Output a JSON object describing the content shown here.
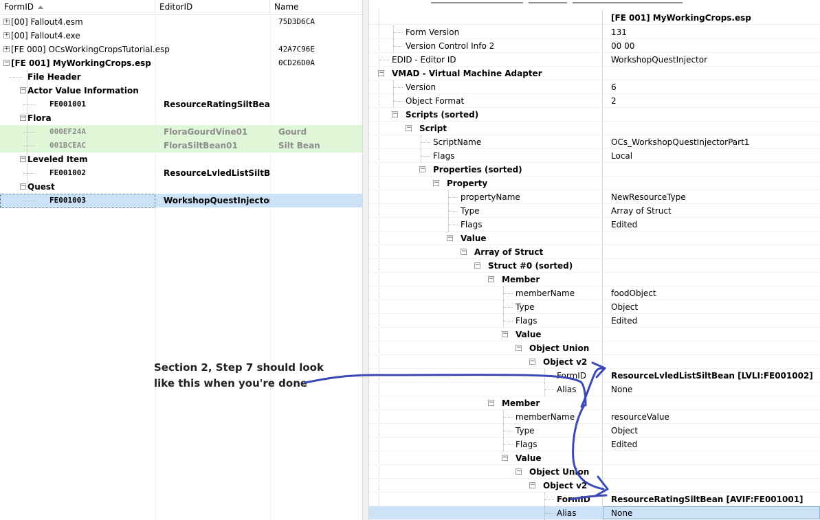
{
  "left_pane": {
    "columns": [
      "FormID",
      "EditorID",
      "Name"
    ],
    "sorted_column": "FormID",
    "rows": [
      {
        "depth": 0,
        "expander": "plus",
        "formid": "[00] Fallout4.esm",
        "editorid": "",
        "name": "75D3D6CA",
        "bold": false,
        "style": "normal"
      },
      {
        "depth": 0,
        "expander": "plus",
        "formid": "[00] Fallout4.exe",
        "editorid": "",
        "name": "",
        "bold": false,
        "style": "normal"
      },
      {
        "depth": 0,
        "expander": "plus",
        "formid": "[FE 000] OCsWorkingCropsTutorial.esp",
        "editorid": "",
        "name": "42A7C96E",
        "bold": false,
        "style": "normal"
      },
      {
        "depth": 0,
        "expander": "minus",
        "formid": "[FE 001] MyWorkingCrops.esp",
        "editorid": "",
        "name": "0CD26D0A",
        "bold": true,
        "style": "normal"
      },
      {
        "depth": 1,
        "expander": "none",
        "formid": "File Header",
        "editorid": "",
        "name": "",
        "bold": true,
        "style": "normal"
      },
      {
        "depth": 1,
        "expander": "minus",
        "formid": "Actor Value Information",
        "editorid": "",
        "name": "",
        "bold": true,
        "style": "normal"
      },
      {
        "depth": 2,
        "expander": "none",
        "formid": "FE001001",
        "editorid": "ResourceRatingSiltBean",
        "name": "",
        "bold": true,
        "style": "normal"
      },
      {
        "depth": 1,
        "expander": "minus",
        "formid": "Flora",
        "editorid": "",
        "name": "",
        "bold": true,
        "style": "normal"
      },
      {
        "depth": 2,
        "expander": "none",
        "formid": "000EF24A",
        "editorid": "FloraGourdVine01",
        "name": "Gourd",
        "bold": true,
        "style": "green"
      },
      {
        "depth": 2,
        "expander": "none",
        "formid": "001BCEAC",
        "editorid": "FloraSiltBean01",
        "name": "Silt Bean",
        "bold": true,
        "style": "green"
      },
      {
        "depth": 1,
        "expander": "minus",
        "formid": "Leveled Item",
        "editorid": "",
        "name": "",
        "bold": true,
        "style": "normal"
      },
      {
        "depth": 2,
        "expander": "none",
        "formid": "FE001002",
        "editorid": "ResourceLvledListSiltBean",
        "name": "",
        "bold": true,
        "style": "normal"
      },
      {
        "depth": 1,
        "expander": "minus",
        "formid": "Quest",
        "editorid": "",
        "name": "",
        "bold": true,
        "style": "normal"
      },
      {
        "depth": 2,
        "expander": "none",
        "formid": "FE001003",
        "editorid": "WorkshopQuestInjector",
        "name": "",
        "bold": true,
        "style": "selected"
      }
    ]
  },
  "right_pane": {
    "header_value": "[FE 001] MyWorkingCrops.esp",
    "rows": [
      {
        "depth": 2,
        "expander": "none",
        "label": "Form Version",
        "value": "131",
        "bold": false
      },
      {
        "depth": 2,
        "expander": "none",
        "label": "Version Control Info 2",
        "value": "00 00",
        "bold": false
      },
      {
        "depth": 1,
        "expander": "none",
        "label": "EDID - Editor ID",
        "value": "WorkshopQuestInjector",
        "bold": false
      },
      {
        "depth": 1,
        "expander": "minus",
        "label": "VMAD - Virtual Machine Adapter",
        "value": "",
        "bold": true
      },
      {
        "depth": 2,
        "expander": "none",
        "label": "Version",
        "value": "6",
        "bold": false
      },
      {
        "depth": 2,
        "expander": "none",
        "label": "Object Format",
        "value": "2",
        "bold": false
      },
      {
        "depth": 2,
        "expander": "minus",
        "label": "Scripts (sorted)",
        "value": "",
        "bold": true
      },
      {
        "depth": 3,
        "expander": "minus",
        "label": "Script",
        "value": "",
        "bold": true
      },
      {
        "depth": 4,
        "expander": "none",
        "label": "ScriptName",
        "value": "OCs_WorkshopQuestInjectorPart1",
        "bold": false
      },
      {
        "depth": 4,
        "expander": "none",
        "label": "Flags",
        "value": "Local",
        "bold": false
      },
      {
        "depth": 4,
        "expander": "minus",
        "label": "Properties (sorted)",
        "value": "",
        "bold": true
      },
      {
        "depth": 5,
        "expander": "minus",
        "label": "Property",
        "value": "",
        "bold": true
      },
      {
        "depth": 6,
        "expander": "none",
        "label": "propertyName",
        "value": "NewResourceType",
        "bold": false
      },
      {
        "depth": 6,
        "expander": "none",
        "label": "Type",
        "value": "Array of Struct",
        "bold": false
      },
      {
        "depth": 6,
        "expander": "none",
        "label": "Flags",
        "value": "Edited",
        "bold": false
      },
      {
        "depth": 6,
        "expander": "minus",
        "label": "Value",
        "value": "",
        "bold": true
      },
      {
        "depth": 7,
        "expander": "minus",
        "label": "Array of Struct",
        "value": "",
        "bold": true
      },
      {
        "depth": 8,
        "expander": "minus",
        "label": "Struct #0 (sorted)",
        "value": "",
        "bold": true
      },
      {
        "depth": 9,
        "expander": "minus",
        "label": "Member",
        "value": "",
        "bold": true
      },
      {
        "depth": 10,
        "expander": "none",
        "label": "memberName",
        "value": "foodObject",
        "bold": false
      },
      {
        "depth": 10,
        "expander": "none",
        "label": "Type",
        "value": "Object",
        "bold": false
      },
      {
        "depth": 10,
        "expander": "none",
        "label": "Flags",
        "value": "Edited",
        "bold": false
      },
      {
        "depth": 10,
        "expander": "minus",
        "label": "Value",
        "value": "",
        "bold": true
      },
      {
        "depth": 11,
        "expander": "minus",
        "label": "Object Union",
        "value": "",
        "bold": true
      },
      {
        "depth": 12,
        "expander": "minus",
        "label": "Object v2",
        "value": "",
        "bold": true
      },
      {
        "depth": 13,
        "expander": "none",
        "label": "FormID",
        "value": "ResourceLvledListSiltBean [LVLI:FE001002]",
        "bold": false,
        "value_bold": true
      },
      {
        "depth": 13,
        "expander": "none",
        "label": "Alias",
        "value": "None",
        "bold": false
      },
      {
        "depth": 9,
        "expander": "minus",
        "label": "Member",
        "value": "",
        "bold": true
      },
      {
        "depth": 10,
        "expander": "none",
        "label": "memberName",
        "value": "resourceValue",
        "bold": false
      },
      {
        "depth": 10,
        "expander": "none",
        "label": "Type",
        "value": "Object",
        "bold": false
      },
      {
        "depth": 10,
        "expander": "none",
        "label": "Flags",
        "value": "Edited",
        "bold": false
      },
      {
        "depth": 10,
        "expander": "minus",
        "label": "Value",
        "value": "",
        "bold": true
      },
      {
        "depth": 11,
        "expander": "minus",
        "label": "Object Union",
        "value": "",
        "bold": true
      },
      {
        "depth": 12,
        "expander": "minus",
        "label": "Object v2",
        "value": "",
        "bold": true
      },
      {
        "depth": 13,
        "expander": "none",
        "label": "FormID",
        "value": "ResourceRatingSiltBean [AVIF:FE001001]",
        "bold": true,
        "value_bold": true
      },
      {
        "depth": 13,
        "expander": "none",
        "label": "Alias",
        "value": "None",
        "bold": false,
        "selected": true
      }
    ]
  },
  "annotation": {
    "line1": "Section 2, Step 7 should look",
    "line2": "like this when you're done"
  },
  "colors": {
    "selection": "#cce2f7",
    "highlight_green": "#dff7d6",
    "ink": "#3a49b8"
  }
}
